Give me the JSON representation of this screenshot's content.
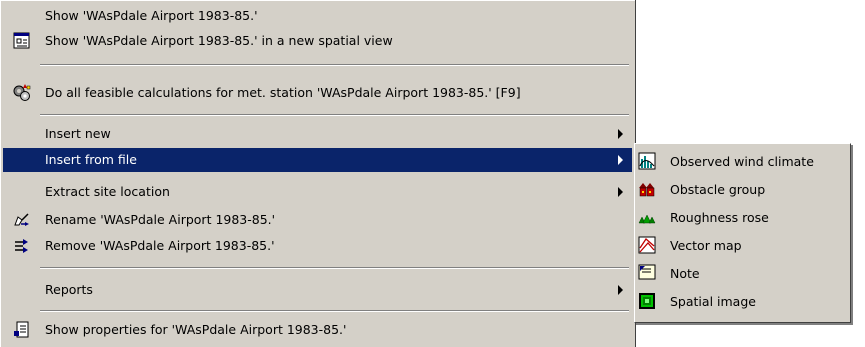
{
  "menu": {
    "items": [
      {
        "label": "Show 'WAsPdale Airport 1983-85.'",
        "icon": null
      },
      {
        "label": "Show 'WAsPdale Airport 1983-85.' in a new spatial view",
        "icon": "spatial-view-icon"
      },
      {
        "label": "Do all feasible calculations for met. station 'WAsPdale Airport 1983-85.' [F9]",
        "icon": "calculate-gears-icon"
      },
      {
        "label": "Insert new",
        "submenu": true
      },
      {
        "label": "Insert from file",
        "submenu": true,
        "highlighted": true
      },
      {
        "label": "Extract site location",
        "submenu": true
      },
      {
        "label": "Rename 'WAsPdale Airport 1983-85.'",
        "icon": "rename-icon"
      },
      {
        "label": "Remove 'WAsPdale Airport 1983-85.'",
        "icon": "remove-icon"
      },
      {
        "label": "Reports",
        "submenu": true
      },
      {
        "label": "Show properties for 'WAsPdale Airport 1983-85.'",
        "icon": "properties-icon"
      }
    ]
  },
  "submenu": {
    "items": [
      {
        "label": "Observed wind climate",
        "icon": "wind-climate-icon"
      },
      {
        "label": "Obstacle group",
        "icon": "obstacle-group-icon"
      },
      {
        "label": "Roughness rose",
        "icon": "roughness-rose-icon"
      },
      {
        "label": "Vector map",
        "icon": "vector-map-icon"
      },
      {
        "label": "Note",
        "icon": "note-icon"
      },
      {
        "label": "Spatial image",
        "icon": "spatial-image-icon"
      }
    ]
  },
  "colors": {
    "menu_bg": "#d4d0c8",
    "highlight": "#0a246a"
  }
}
